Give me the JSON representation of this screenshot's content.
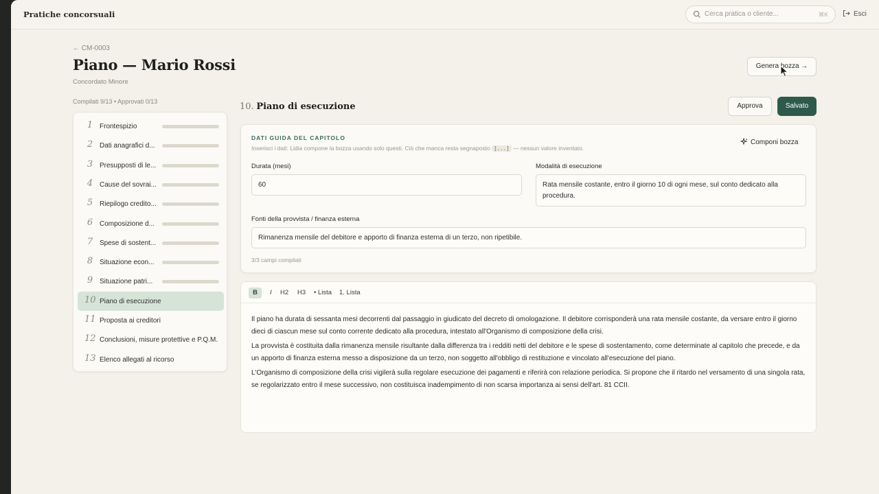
{
  "app": {
    "title": "Pratiche concorsuali"
  },
  "search": {
    "placeholder": "Cerca pratica o cliente...",
    "shortcut": "⌘K"
  },
  "logout": {
    "label": "Esci"
  },
  "header": {
    "back_label": "← CM-0003",
    "title": "Piano — Mario Rossi",
    "subtitle": "Concordato Minore",
    "generate_button": "Genera bozza →"
  },
  "progress": {
    "text": "Compilati 9/13 • Approvati 0/13"
  },
  "sidebar": {
    "items": [
      {
        "num": "1",
        "label": "Frontespizio",
        "bar": true
      },
      {
        "num": "2",
        "label": "Dati anagrafici d...",
        "bar": true
      },
      {
        "num": "3",
        "label": "Presupposti di le...",
        "bar": true
      },
      {
        "num": "4",
        "label": "Cause del sovrai...",
        "bar": true
      },
      {
        "num": "5",
        "label": "Riepilogo credito...",
        "bar": true
      },
      {
        "num": "6",
        "label": "Composizione d...",
        "bar": true
      },
      {
        "num": "7",
        "label": "Spese di sostent...",
        "bar": true
      },
      {
        "num": "8",
        "label": "Situazione econ...",
        "bar": true
      },
      {
        "num": "9",
        "label": "Situazione patri...",
        "bar": true
      },
      {
        "num": "10",
        "label": "Piano di esecuzione",
        "bar": false,
        "active": true
      },
      {
        "num": "11",
        "label": "Proposta ai creditori",
        "bar": false
      },
      {
        "num": "12",
        "label": "Conclusioni, misure protettive e P.Q.M.",
        "bar": false
      },
      {
        "num": "13",
        "label": "Elenco allegati al ricorso",
        "bar": false
      }
    ]
  },
  "section": {
    "number": "10.",
    "title": "Piano di esecuzione",
    "approve_button": "Approva",
    "saved_button": "Salvato"
  },
  "guide": {
    "heading": "DATI GUIDA DEL CAPITOLO",
    "hint_before": "Inserisci i dati: Lidia compone la bozza usando solo questi. Ciò che manca resta segnaposto",
    "hint_chip": "[...]",
    "hint_after": "— nessun valore inventato.",
    "compose_button": "Componi bozza",
    "fields": {
      "duration_label": "Durata (mesi)",
      "duration_value": "60",
      "mode_label": "Modalità di esecuzione",
      "mode_value": "Rata mensile costante, entro il giorno 10 di ogni mese, sul conto dedicato alla procedura.",
      "sources_label": "Fonti della provvista / finanza esterna",
      "sources_value": "Rimanenza mensile del debitore e apporto di finanza esterna di un terzo, non ripetibile."
    },
    "count": "3/3 campi compilati"
  },
  "editor": {
    "toolbar": {
      "bold": "B",
      "italic": "I",
      "h2": "H2",
      "h3": "H3",
      "bullet": "• Lista",
      "numbered": "1. Lista"
    },
    "paragraphs": [
      "Il piano ha durata di sessanta mesi decorrenti dal passaggio in giudicato del decreto di omologazione. Il debitore corrisponderà una rata mensile costante, da versare entro il giorno dieci di ciascun mese sul conto corrente dedicato alla procedura, intestato all'Organismo di composizione della crisi.",
      "La provvista è costituita dalla rimanenza mensile risultante dalla differenza tra i redditi netti del debitore e le spese di sostentamento, come determinate al capitolo che precede, e da un apporto di finanza esterna messo a disposizione da un terzo, non soggetto all'obbligo di restituzione e vincolato all'esecuzione del piano.",
      "L'Organismo di composizione della crisi vigilerà sulla regolare esecuzione dei pagamenti e riferirà con relazione periodica. Si propone che il ritardo nel versamento di una singola rata, se regolarizzato entro il mese successivo, non costituisca inadempimento di non scarsa importanza ai sensi dell'art. 81 CCII."
    ]
  },
  "colors": {
    "accent": "#2e5a4c",
    "active_bg": "#d6e4d8",
    "background": "#f3f1ea"
  }
}
